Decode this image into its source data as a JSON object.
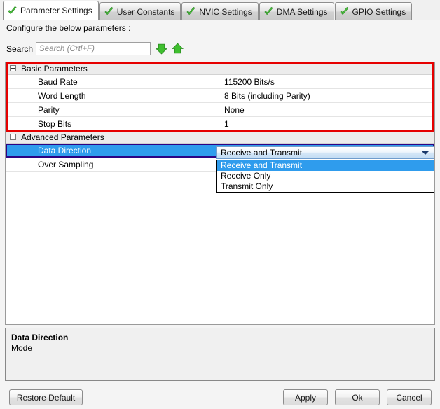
{
  "window": {
    "instruction": "Configure the below parameters :"
  },
  "tabs": [
    {
      "label": "Parameter Settings",
      "active": true
    },
    {
      "label": "User Constants",
      "active": false
    },
    {
      "label": "NVIC Settings",
      "active": false
    },
    {
      "label": "DMA Settings",
      "active": false
    },
    {
      "label": "GPIO Settings",
      "active": false
    }
  ],
  "search": {
    "label": "Search :",
    "placeholder": "Search (Crtl+F)",
    "value": "",
    "next_icon": "arrow-down-icon",
    "prev_icon": "arrow-up-icon",
    "list_icon": "list-view-icon"
  },
  "groups": [
    {
      "title": "Basic Parameters",
      "collapsed": false,
      "rows": [
        {
          "name": "Baud Rate",
          "value": "115200 Bits/s"
        },
        {
          "name": "Word Length",
          "value": "8 Bits (including Parity)"
        },
        {
          "name": "Parity",
          "value": "None"
        },
        {
          "name": "Stop Bits",
          "value": "1"
        }
      ]
    },
    {
      "title": "Advanced Parameters",
      "collapsed": false,
      "rows": [
        {
          "name": "Data Direction",
          "value": "Receive and Transmit",
          "selected": true
        },
        {
          "name": "Over Sampling",
          "value": ""
        }
      ]
    }
  ],
  "combo": {
    "value": "Receive and Transmit",
    "open": true,
    "options": [
      {
        "label": "Receive and Transmit",
        "selected": true
      },
      {
        "label": "Receive Only",
        "selected": false
      },
      {
        "label": "Transmit Only",
        "selected": false
      }
    ]
  },
  "description": {
    "title": "Data Direction",
    "body": "Mode"
  },
  "buttons": {
    "restore_default": "Restore Default",
    "apply": "Apply",
    "ok": "Ok",
    "cancel": "Cancel"
  },
  "annotations": {
    "basic_parameters_highlight_color": "#e60000",
    "selected_row_outline_color": "#2c0383",
    "selection_blue": "#2f9ced"
  }
}
